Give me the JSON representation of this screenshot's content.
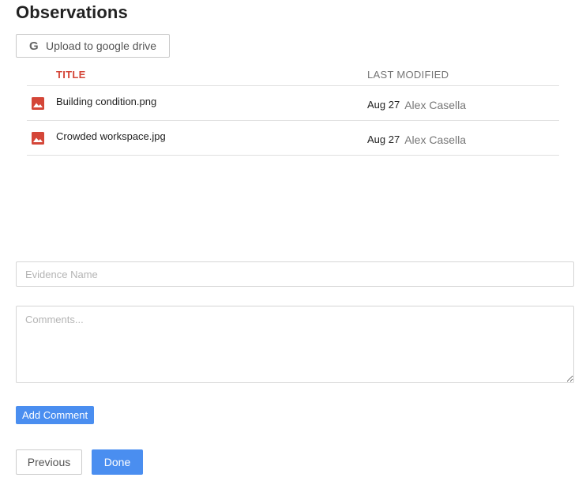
{
  "page": {
    "title": "Observations"
  },
  "upload": {
    "icon": "google-g-icon",
    "icon_glyph": "G",
    "label": "Upload to google drive"
  },
  "files": {
    "headers": {
      "title": "TITLE",
      "last_modified": "LAST MODIFIED"
    },
    "rows": [
      {
        "icon": "image-file-icon",
        "name": "Building condition.png",
        "date": "Aug 27",
        "author": "Alex Casella"
      },
      {
        "icon": "image-file-icon",
        "name": "Crowded workspace.jpg",
        "date": "Aug 27",
        "author": "Alex Casella"
      }
    ]
  },
  "form": {
    "evidence_placeholder": "Evidence Name",
    "comments_placeholder": "Comments...",
    "add_comment_label": "Add Comment"
  },
  "nav": {
    "previous_label": "Previous",
    "done_label": "Done"
  },
  "colors": {
    "accent_blue": "#4a8ef0",
    "title_header_red": "#d44638",
    "file_icon_red": "#d44638"
  }
}
